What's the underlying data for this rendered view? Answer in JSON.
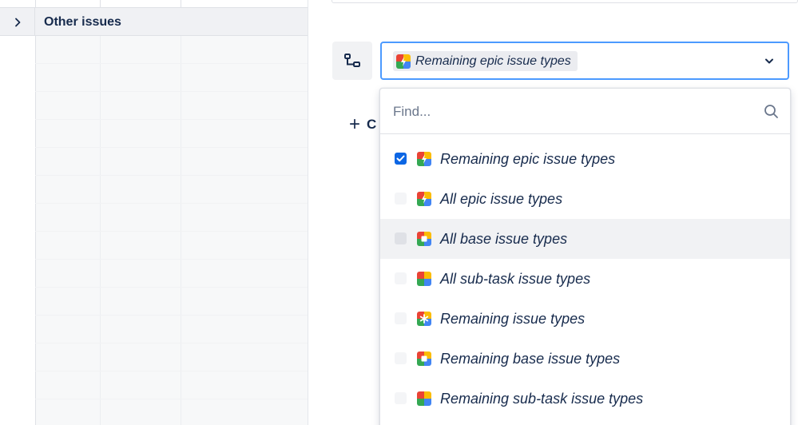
{
  "grid": {
    "group_title": "Other issues"
  },
  "field": {
    "selected_label": "Remaining epic issue types",
    "add_label": "C"
  },
  "dropdown": {
    "find_placeholder": "Find...",
    "options": [
      {
        "label": "Remaining epic issue types",
        "checked": true,
        "icon": "epic-lightning-icon"
      },
      {
        "label": "All epic issue types",
        "checked": false,
        "icon": "epic-lightning-icon"
      },
      {
        "label": "All base issue types",
        "checked": false,
        "icon": "base-square-icon"
      },
      {
        "label": "All sub-task issue types",
        "checked": false,
        "icon": "subtask-quad-icon"
      },
      {
        "label": "Remaining issue types",
        "checked": false,
        "icon": "asterisk-icon"
      },
      {
        "label": "Remaining base issue types",
        "checked": false,
        "icon": "base-square-icon"
      },
      {
        "label": "Remaining sub-task issue types",
        "checked": false,
        "icon": "subtask-quad-icon"
      }
    ]
  },
  "colors": {
    "focus_border": "#4c9aff",
    "checkbox_checked": "#0c66e4",
    "icon_red": "#ea4335",
    "icon_yellow": "#fbbc04",
    "icon_green": "#34a853",
    "icon_blue": "#4285f4"
  }
}
